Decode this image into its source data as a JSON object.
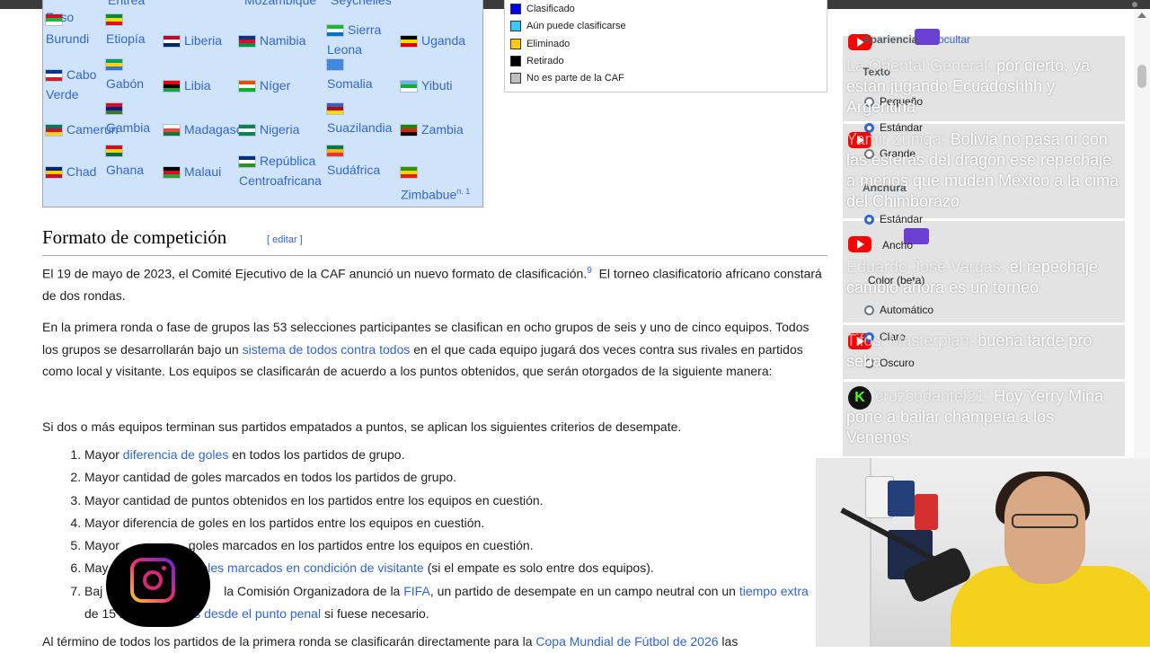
{
  "table": {
    "top_partials": [
      "Faso",
      "Entrea",
      "Mozambique",
      "Seychelles"
    ],
    "rows": [
      [
        {
          "name": "Burundi",
          "flag": [
            "#ce1126",
            "#1eb53a",
            "#ffffff"
          ]
        },
        {
          "name": "Etiopía",
          "flag": [
            "#078930",
            "#fcdd09",
            "#da121a"
          ]
        },
        {
          "name": "Liberia",
          "flag": [
            "#bf0a30",
            "#ffffff",
            "#002868"
          ]
        },
        {
          "name": "Namibia",
          "flag": [
            "#003580",
            "#d21034",
            "#009543"
          ]
        },
        {
          "name": "Sierra Leona",
          "flag": [
            "#1eb53a",
            "#ffffff",
            "#0072c6"
          ]
        },
        {
          "name": "Uganda",
          "flag": [
            "#000000",
            "#fcdc04",
            "#d90000"
          ]
        }
      ],
      [
        {
          "name": "Cabo Verde",
          "flag": [
            "#003893",
            "#ffffff",
            "#cf2027"
          ]
        },
        {
          "name": "Gabón",
          "flag": [
            "#009e60",
            "#fcd116",
            "#3a75c4"
          ]
        },
        {
          "name": "Libia",
          "flag": [
            "#e70013",
            "#000000",
            "#239e46"
          ]
        },
        {
          "name": "Níger",
          "flag": [
            "#e05206",
            "#ffffff",
            "#0db02b"
          ]
        },
        {
          "name": "Somalia",
          "flag": [
            "#4189dd",
            "#4189dd",
            "#4189dd"
          ]
        },
        {
          "name": "Yibuti",
          "flag": [
            "#6ab2e7",
            "#12ad2b",
            "#ffffff"
          ]
        }
      ],
      [
        {
          "name": "Camerún",
          "flag": [
            "#007a5e",
            "#ce1126",
            "#fcd116"
          ]
        },
        {
          "name": "Gambia",
          "flag": [
            "#ce1126",
            "#0c1c8c",
            "#3a7728"
          ]
        },
        {
          "name": "Madagascar",
          "flag": [
            "#ffffff",
            "#fc3d32",
            "#007e3a"
          ]
        },
        {
          "name": "Nigeria",
          "flag": [
            "#008751",
            "#ffffff",
            "#008751"
          ]
        },
        {
          "name": "Suazilandia",
          "flag": [
            "#3e5eb9",
            "#b10c0c",
            "#ffd900"
          ]
        },
        {
          "name": "Zambia",
          "flag": [
            "#198a00",
            "#de2010",
            "#000000"
          ]
        }
      ],
      [
        {
          "name": "Chad",
          "flag": [
            "#002664",
            "#fecb00",
            "#c60c30"
          ]
        },
        {
          "name": "Ghana",
          "flag": [
            "#ce1126",
            "#fcd116",
            "#006b3f"
          ]
        },
        {
          "name": "Malaui",
          "flag": [
            "#000000",
            "#ce1126",
            "#339e35"
          ]
        },
        {
          "name": "República Centroafricana",
          "flag": [
            "#003082",
            "#ffffff",
            "#289728"
          ]
        },
        {
          "name": "Sudáfrica",
          "flag": [
            "#007a4d",
            "#ffb612",
            "#de3831"
          ]
        },
        {
          "name": "Zimbabue",
          "flag": [
            "#319208",
            "#ffd200",
            "#de2010"
          ]
        }
      ]
    ],
    "zimbabwe_note": "n. 1"
  },
  "legend": {
    "items": [
      {
        "label": "Clasificado",
        "color": "#0000ff"
      },
      {
        "label": "Aún puede clasificarse",
        "color": "#33ccff"
      },
      {
        "label": "Eliminado",
        "color": "#ffcc00"
      },
      {
        "label": "Retirado",
        "color": "#000000"
      },
      {
        "label": "No es parte de la CAF",
        "color": "#c0c0c0"
      }
    ]
  },
  "section": {
    "title": "Formato de competición",
    "edit_label": "[ editar ]"
  },
  "article": {
    "p1_a": "El 19 de mayo de 2023, el Comité Ejecutivo de la CAF anunció un nuevo formato de clasificación.",
    "p1_ref": "9",
    "p1_b": "El torneo clasificatorio africano constará de dos rondas.",
    "p2_a": "En la primera ronda o fase de grupos las 53 selecciones participantes se clasifican en ocho grupos de seis y uno de cinco equipos. Todos los grupos se desarrollarán bajo un ",
    "p2_link": "sistema de todos contra todos",
    "p2_b": " en el que cada equipo jugará dos veces contra sus rivales en partidos como local y visitante. Los equipos se clasificarán de acuerdo a los puntos obtenidos, que serán otorgados de la siguiente manera:",
    "p3": "Si dos o más equipos terminan sus partidos empatados a puntos, se aplican los siguientes criterios de desempate.",
    "criteria": {
      "c1_a": "Mayor ",
      "c1_link": "diferencia de goles",
      "c1_b": " en todos los partidos de grupo.",
      "c2": "Mayor cantidad de goles marcados en todos los partidos de grupo.",
      "c3": "Mayor cantidad de puntos obtenidos en los partidos entre los equipos en cuestión.",
      "c4": "Mayor diferencia de goles en los partidos entre los equipos en cuestión.",
      "c5_a": "Mayor",
      "c5_b": "goles marcados en los partidos entre los equipos en cuestión.",
      "c6_a": "May",
      "c6_link": "oles marcados en condición de visitante",
      "c6_b": " (si el empate es solo entre dos equipos).",
      "c7_a": "Baj",
      "c7_b": "la Comisión Organizadora de la ",
      "c7_link1": "FIFA",
      "c7_c": ", un partido de desempate en un campo neutral con un ",
      "c7_link2": "tiempo extra",
      "c7_d": "os de 15 minutos y ",
      "c7_link3": "tiros desde el punto penal",
      "c7_e": " si fuese necesario."
    },
    "p4_a": "Al término de todos los partidos de la primera ronda se clasificarán directamente para la ",
    "p4_link": "Copa Mundial de Fútbol de 2026",
    "p4_b": " las"
  },
  "chat": {
    "messages": [
      {
        "platform": "youtube",
        "user": "La Oriental General:",
        "text": "por cierto, ya estan jugando Ecuadoshhh y Argentina"
      },
      {
        "platform": "youtube",
        "user": "Yamir Zúñiga:",
        "text": "Bolivia no pasa ni con las esferas del dragón ese repechaje a menos que muden México a la cima del Chimborazo"
      },
      {
        "platform": "youtube",
        "user": "Eduardo José Vargas:",
        "text": "el repechaje cambio ahora es un torneo"
      },
      {
        "platform": "youtube",
        "user": "Tifosi Masterplan:",
        "text": "buena tarde pro seba"
      },
      {
        "platform": "kick",
        "user": "cruzcodantel21:",
        "text": "Hoy Yerry Mina pone a bailar champeta a los Venenos"
      }
    ]
  },
  "appearance": {
    "heading": "Apariencia",
    "hide_label": "ocultar",
    "text_label": "Texto",
    "small": "Pequeño",
    "standard": "Estándar",
    "large": "Grande",
    "width_label": "Anchura",
    "width_standard": "Estándar",
    "wide": "Ancho",
    "color_label": "Color (beta)",
    "automatic": "Automático",
    "light": "Claro",
    "dark": "Oscuro"
  },
  "icons": {
    "youtube": "youtube-icon",
    "kick": "kick-icon",
    "instagram": "instagram-icon",
    "kick_glyph": "K"
  }
}
